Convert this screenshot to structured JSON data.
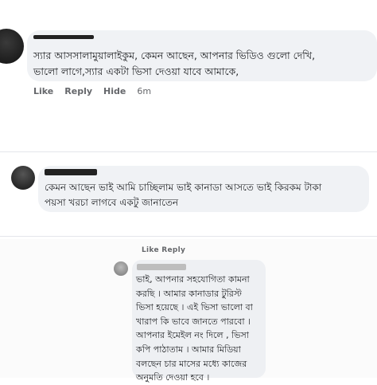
{
  "comments": [
    {
      "text_lines": [
        "স্যার আসসালামুয়ালাইকুম, কেমন আছেন, আপনার ভিডিও গুলো দেখি,",
        "ভালো লাগে,স্যার একটা ভিসা দেওয়া যাবে আমাকে,"
      ],
      "actions": {
        "like": "Like",
        "reply": "Reply",
        "hide": "Hide",
        "time": "6m"
      }
    },
    {
      "text_lines": [
        "কেমন আছেন ভাই আমি চাচ্ছিলাম ভাই কানাডা আসতে ভাই কিরকম টাকা",
        "পয়সা খরচা লাগবে একটু জানাতেন"
      ]
    },
    {
      "cut_actions": "Like   Reply",
      "text_lines": [
        "ভাই, আপনার  সহযোগিতা কামনা",
        "করছি । আমার কানাডার টুরিস্ট",
        "ভিসা হয়েছে । এই ভিসা ভালো বা",
        "খারাপ কি ভাবে জানতে পারবো ।",
        "আপনার ইমেইল  নং দিলে  , ভিসা",
        "কপি পাঠাতাম  । আমার মিডিয়া",
        "বলছেন চার মাসের মধ্যে কাজের",
        "অনুমতি দেওয়া হবে ।"
      ]
    }
  ],
  "colors": {
    "bubble": "#f0f2f5",
    "action_text": "#65676b",
    "text": "#1c1e21"
  }
}
